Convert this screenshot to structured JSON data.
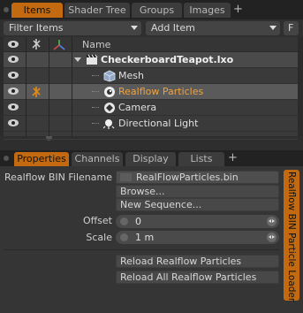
{
  "top_tabs": [
    "Items",
    "Shader Tree",
    "Groups",
    "Images"
  ],
  "top_add_label": "+",
  "filter": {
    "filter_label": "Filter Items",
    "add_item_label": "Add Item",
    "f_button": "F"
  },
  "list": {
    "column_name": "Name",
    "rows": [
      {
        "label": "CheckerboardTeapot.lxo",
        "icon": "scene-clapper-icon"
      },
      {
        "label": "Mesh",
        "icon": "mesh-cube-icon"
      },
      {
        "label": "Realflow Particles",
        "icon": "particles-icon"
      },
      {
        "label": "Camera",
        "icon": "camera-icon"
      },
      {
        "label": "Directional Light",
        "icon": "light-icon"
      }
    ]
  },
  "prop_tabs": [
    "Properties",
    "Channels",
    "Display",
    "Lists"
  ],
  "prop_add_label": "+",
  "props": {
    "bin_label": "Realflow BIN Filename",
    "bin_value": "RealFlowParticles.bin",
    "browse": "Browse...",
    "new_sequence": "New Sequence...",
    "offset_label": "Offset",
    "offset_value": "0",
    "scale_label": "Scale",
    "scale_value": "1 m",
    "reload": "Reload Realflow Particles",
    "reload_all": "Reload All Realflow Particles"
  },
  "side_tab": "Realflow BIN Particle Loader",
  "colors": {
    "accent": "#c36a10",
    "selected_row": "#5a5a5a",
    "background": "#2b2b2b"
  }
}
